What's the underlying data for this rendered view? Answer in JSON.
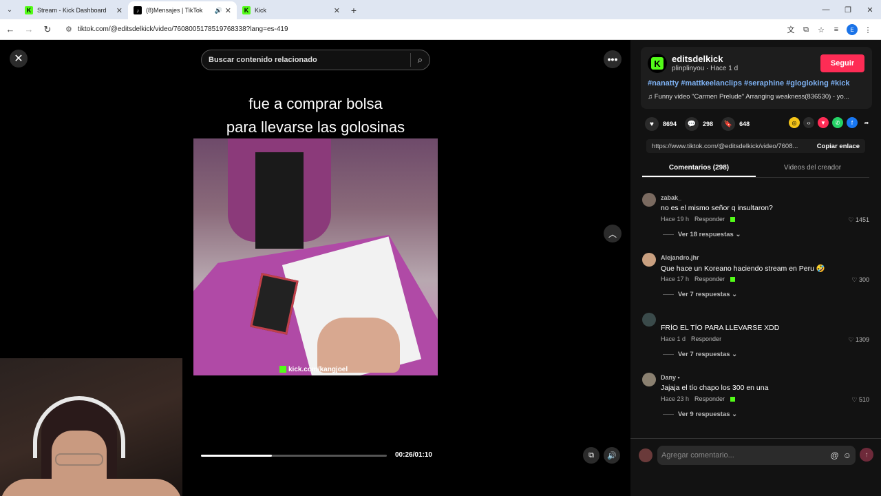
{
  "browser": {
    "tabs": [
      {
        "title": "Stream - Kick Dashboard",
        "icon": "kick-logo-icon"
      },
      {
        "title": "(8)Mensajes | TikTok",
        "icon": "tiktok-logo-icon"
      },
      {
        "title": "Kick",
        "icon": "kick-logo-icon"
      }
    ],
    "url": "tiktok.com/@editsdelkick/video/7608005178519768338?lang=es-419"
  },
  "viewer": {
    "search_placeholder": "Buscar contenido relacionado",
    "caption_line1": "fue a comprar bolsa",
    "caption_line2": "para llevarse las golosinas",
    "watermark": "kick.com/kangjoel",
    "time": "00:26/01:10",
    "progress_fraction": 0.38
  },
  "creator": {
    "username": "editsdelkick",
    "subline": "plinplinyou · Hace 1 d",
    "follow_label": "Seguir",
    "hashtags": "#nanatty #mattkeelanclips #seraphine #glogloking #kick",
    "music": "Funny video \"Carmen Prelude\" Arranging weakness(836530) - yo..."
  },
  "stats": {
    "likes": "8694",
    "comments": "298",
    "saves": "648"
  },
  "link": {
    "url": "https://www.tiktok.com/@editsdelkick/video/7608...",
    "copy_label": "Copiar enlace"
  },
  "tabs": {
    "comments": "Comentarios (298)",
    "creator_videos": "Videos del creador"
  },
  "comments": [
    {
      "name": "zabak_",
      "text": "no es el mismo señor q insultaron?",
      "time": "Hace 19 h",
      "reply": "Responder",
      "likes": "1451",
      "more": "Ver 18 respuestas"
    },
    {
      "name": "Alejandro.jhr",
      "text": "Que hace un Koreano haciendo stream en Peru 🤣",
      "time": "Hace 17 h",
      "reply": "Responder",
      "likes": "300",
      "more": "Ver 7 respuestas"
    },
    {
      "name": "",
      "text": "FRÍO EL TÍO PARA LLEVARSE XDD",
      "time": "Hace 1 d",
      "reply": "Responder",
      "likes": "1309",
      "more": "Ver 7 respuestas"
    },
    {
      "name": "Dany •",
      "text": "Jajaja el tío chapo los 300 en una",
      "time": "Hace 23 h",
      "reply": "Responder",
      "likes": "510",
      "more": "Ver 9 respuestas"
    }
  ],
  "comment_input": {
    "placeholder": "Agregar comentario..."
  }
}
